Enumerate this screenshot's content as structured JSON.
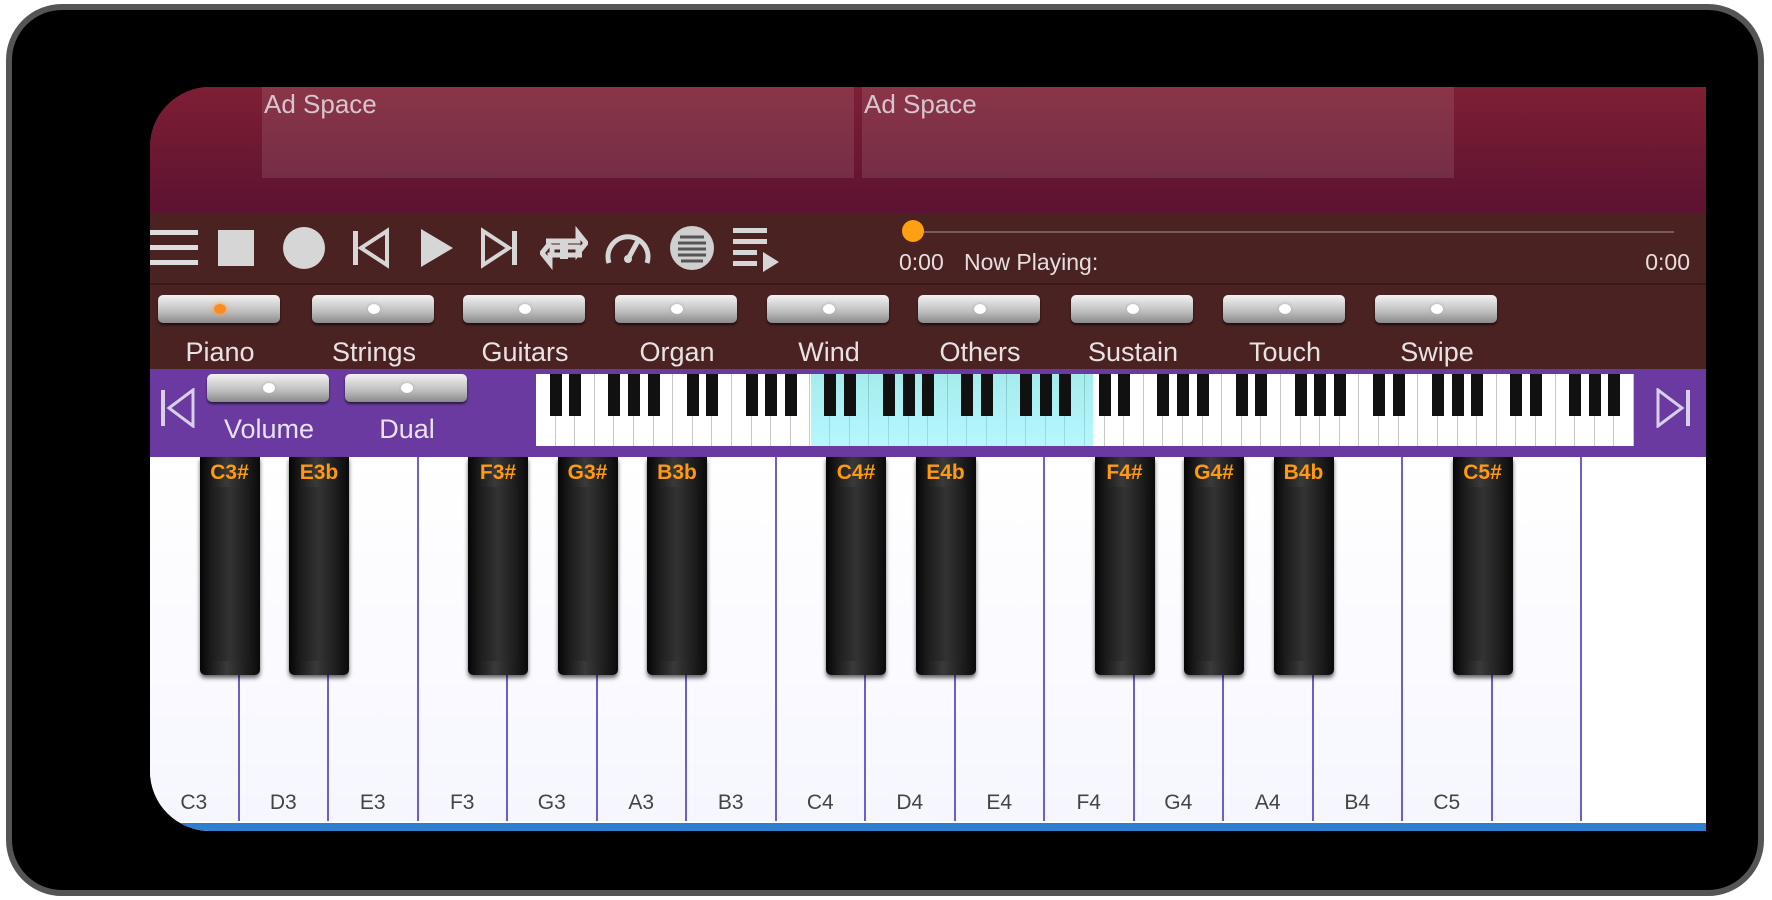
{
  "ads": [
    {
      "label": "Ad Space"
    },
    {
      "label": "Ad Space"
    }
  ],
  "transport": {
    "buttons": [
      "menu-icon",
      "stop-icon",
      "record-icon",
      "skip-previous-icon",
      "play-icon",
      "skip-next-icon",
      "repeat-icon",
      "speed-gauge-icon",
      "metronome-icon",
      "playlist-icon"
    ],
    "time_start": "0:00",
    "now_playing": "Now Playing:",
    "time_end": "0:00",
    "progress": 0
  },
  "instruments": [
    {
      "label": "Piano",
      "on": true
    },
    {
      "label": "Strings",
      "on": false
    },
    {
      "label": "Guitars",
      "on": false
    },
    {
      "label": "Organ",
      "on": false
    },
    {
      "label": "Wind",
      "on": false
    },
    {
      "label": "Others",
      "on": false
    },
    {
      "label": "Sustain",
      "on": false
    },
    {
      "label": "Touch",
      "on": false
    },
    {
      "label": "Swipe",
      "on": false
    }
  ],
  "controls": {
    "volume_label": "Volume",
    "dual_label": "Dual"
  },
  "colors": {
    "accent": "#ffa012",
    "panel": "#4a2222",
    "frame": "#6a3aa0",
    "black_key_label": "#ff9a10"
  },
  "keyboard": {
    "white_keys": [
      "C3",
      "D3",
      "E3",
      "F3",
      "G3",
      "A3",
      "B3",
      "C4",
      "D4",
      "E4",
      "F4",
      "G4",
      "A4",
      "B4",
      "C5",
      ""
    ],
    "black_keys": [
      {
        "label": "C3#",
        "after": 0
      },
      {
        "label": "E3b",
        "after": 1
      },
      {
        "label": "F3#",
        "after": 3
      },
      {
        "label": "G3#",
        "after": 4
      },
      {
        "label": "B3b",
        "after": 5
      },
      {
        "label": "C4#",
        "after": 7
      },
      {
        "label": "E4b",
        "after": 8
      },
      {
        "label": "F4#",
        "after": 10
      },
      {
        "label": "G4#",
        "after": 11
      },
      {
        "label": "B4b",
        "after": 12
      },
      {
        "label": "C5#",
        "after": 14
      }
    ]
  }
}
